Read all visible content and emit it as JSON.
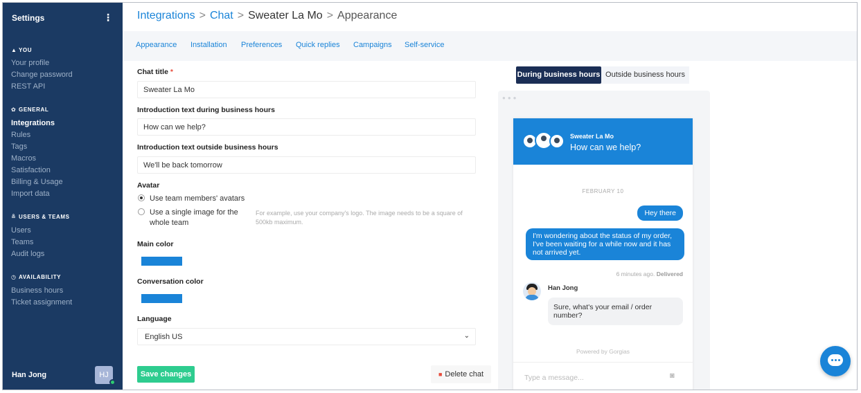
{
  "sidebar": {
    "title": "Settings",
    "menu_icon": "kebab-icon",
    "sections": {
      "you": {
        "label": "YOU",
        "items": [
          "Your profile",
          "Change password",
          "REST API"
        ]
      },
      "general": {
        "label": "GENERAL",
        "items": [
          "Integrations",
          "Rules",
          "Tags",
          "Macros",
          "Satisfaction",
          "Billing & Usage",
          "Import data"
        ]
      },
      "users_teams": {
        "label": "USERS & TEAMS",
        "items": [
          "Users",
          "Teams",
          "Audit logs"
        ]
      },
      "availability": {
        "label": "AVAILABILITY",
        "items": [
          "Business hours",
          "Ticket assignment"
        ]
      }
    },
    "active_item": "Integrations",
    "user": {
      "name": "Han Jong",
      "initials": "HJ"
    }
  },
  "breadcrumb": {
    "parts": [
      "Integrations",
      "Chat",
      "Sweater La Mo",
      "Appearance"
    ],
    "separator": ">"
  },
  "tabs": [
    "Appearance",
    "Installation",
    "Preferences",
    "Quick replies",
    "Campaigns",
    "Self-service"
  ],
  "form": {
    "chat_title": {
      "label": "Chat title",
      "required_mark": "*",
      "value": "Sweater La Mo"
    },
    "intro_during": {
      "label": "Introduction text during business hours",
      "value": "How can we help?"
    },
    "intro_outside": {
      "label": "Introduction text outside business hours",
      "value": "We'll be back tomorrow"
    },
    "avatar": {
      "label": "Avatar",
      "option_team": "Use team members' avatars",
      "option_single_line1": "Use a single image for the",
      "option_single_line2": "whole team",
      "hint_line1": "For example, use your company's logo. The image needs to be a square of",
      "hint_line2": "500kb maximum.",
      "selected": "team"
    },
    "main_color": {
      "label": "Main color",
      "value": "#1a84d8"
    },
    "conversation_color": {
      "label": "Conversation color",
      "value": "#1a84d8"
    },
    "language": {
      "label": "Language",
      "value": "English US"
    },
    "save_label": "Save changes",
    "delete_label": "Delete chat"
  },
  "preview": {
    "toggle": {
      "during": "During business hours",
      "outside": "Outside business hours",
      "active": "during"
    },
    "widget": {
      "name": "Sweater La Mo",
      "intro": "How can we help?",
      "date": "FEBRUARY 10",
      "msg1": "Hey there",
      "msg2_line1": "I'm wondering about the status of my order,",
      "msg2_line2": "I've been waiting for a while now and it has",
      "msg2_line3": "not arrived yet.",
      "meta_time": "6 minutes ago.",
      "meta_status": "Delivered",
      "agent_name": "Han Jong",
      "reply_line1": "Sure, what's your email / order",
      "reply_line2": "number?",
      "powered": "Powered by Gorgias",
      "input_placeholder": "Type a message..."
    }
  }
}
